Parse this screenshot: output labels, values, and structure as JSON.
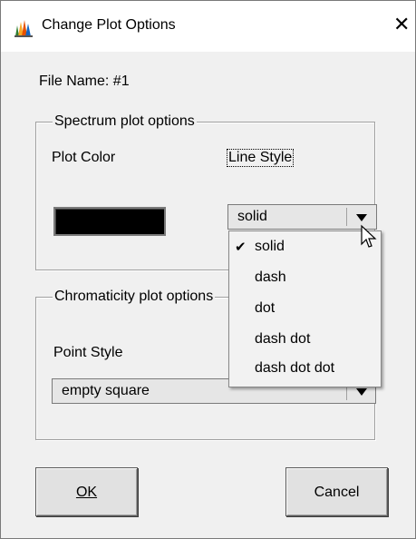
{
  "window": {
    "title": "Change Plot Options",
    "close_symbol": "✕"
  },
  "file_name_label": "File Name:  #1",
  "spectrum_group": {
    "title": "Spectrum plot options",
    "plot_color_label": "Plot Color",
    "plot_color_value": "#000000",
    "line_style_label": "Line Style",
    "line_style_selected": "solid",
    "line_style_options": [
      "solid",
      "dash",
      "dot",
      "dash dot",
      "dash dot dot"
    ],
    "check_mark": "✔"
  },
  "chromaticity_group": {
    "title": "Chromaticity plot options",
    "point_style_label": "Point Style",
    "point_style_selected": "empty square"
  },
  "buttons": {
    "ok": "OK",
    "cancel": "Cancel"
  }
}
